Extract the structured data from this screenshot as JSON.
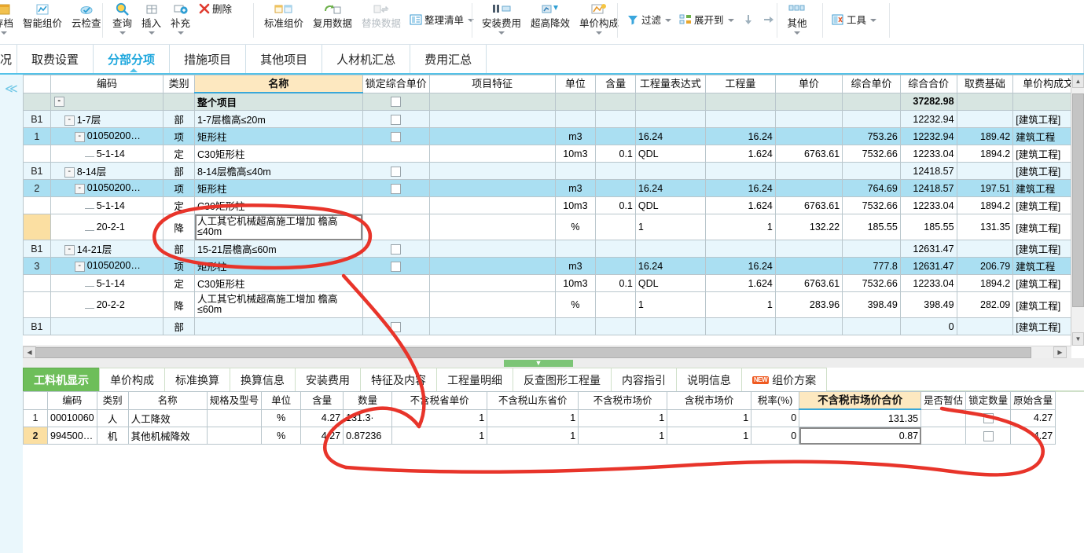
{
  "ribbon": {
    "groups": [
      {
        "items": [
          {
            "label": "存档",
            "icon": "archive-icon",
            "caret": true
          },
          {
            "label": "智能组价",
            "icon": "smart-price-icon",
            "caret": false
          },
          {
            "label": "云检查",
            "icon": "cloud-check-icon",
            "caret": false
          }
        ]
      },
      {
        "items": [
          {
            "label": "查询",
            "icon": "search-icon",
            "caret": true
          },
          {
            "label": "插入",
            "icon": "insert-row-icon",
            "caret": true
          },
          {
            "label": "补充",
            "icon": "supplement-icon",
            "caret": true
          },
          {
            "label": "删除",
            "icon": "delete-icon",
            "caret": false,
            "inline": true
          }
        ]
      },
      {
        "items": [
          {
            "label": "标准组价",
            "icon": "standard-price-icon",
            "caret": false
          },
          {
            "label": "复用数据",
            "icon": "reuse-data-icon",
            "caret": false
          },
          {
            "label": "替换数据",
            "icon": "replace-data-icon",
            "caret": false,
            "disabled": true
          },
          {
            "label": "整理清单",
            "icon": "organize-list-icon",
            "caret": true,
            "inline": true
          }
        ]
      },
      {
        "items": [
          {
            "label": "安装费用",
            "icon": "install-fee-icon",
            "caret": true
          },
          {
            "label": "超高降效",
            "icon": "height-efficiency-icon",
            "caret": false
          },
          {
            "label": "单价构成",
            "icon": "unit-price-composition-icon",
            "caret": true
          }
        ]
      },
      {
        "items": [
          {
            "label": "过滤",
            "icon": "filter-icon",
            "caret": true,
            "inline": true
          },
          {
            "label": "展开到",
            "icon": "expand-to-icon",
            "caret": true,
            "inline": true
          },
          {
            "label": "",
            "icon": "arrow-down-icon",
            "caret": false,
            "inline": true
          },
          {
            "label": "",
            "icon": "arrow-right-icon",
            "caret": false,
            "inline": true
          }
        ]
      },
      {
        "items": [
          {
            "label": "其他",
            "icon": "other-icon",
            "caret": true
          }
        ]
      },
      {
        "items": [
          {
            "label": "工具",
            "icon": "tools-icon",
            "caret": true,
            "inline": true
          }
        ]
      }
    ]
  },
  "main_tabs": {
    "leading_partial": "况",
    "items": [
      {
        "label": "取费设置",
        "active": false
      },
      {
        "label": "分部分项",
        "active": true
      },
      {
        "label": "措施项目",
        "active": false
      },
      {
        "label": "其他项目",
        "active": false
      },
      {
        "label": "人材机汇总",
        "active": false
      },
      {
        "label": "费用汇总",
        "active": false
      }
    ]
  },
  "top_grid": {
    "columns": [
      "编码",
      "类别",
      "名称",
      "锁定综合单价",
      "项目特征",
      "单位",
      "含量",
      "工程量表达式",
      "工程量",
      "单价",
      "综合单价",
      "综合合价",
      "取费基础",
      "单价构成文"
    ],
    "selected_column": "名称",
    "rows": [
      {
        "rowhd": "",
        "type": "proj",
        "code": "",
        "cat": "",
        "name": "整个项目",
        "lock": true,
        "feature": "",
        "unit": "",
        "content": "",
        "expr": "",
        "qty": "",
        "price": "",
        "uprice": "",
        "total": "37282.98",
        "base": "",
        "compose": "",
        "indent": 0,
        "expander": "-"
      },
      {
        "rowhd": "B1",
        "type": "bu",
        "code": "1-7层",
        "cat": "部",
        "name": "1-7层檐高≤20m",
        "lock": true,
        "feature": "",
        "unit": "",
        "content": "",
        "expr": "",
        "qty": "",
        "price": "",
        "uprice": "",
        "total": "12232.94",
        "base": "",
        "compose": "[建筑工程]",
        "indent": 1,
        "expander": "-"
      },
      {
        "rowhd": "1",
        "type": "item",
        "code": "01050200…",
        "cat": "项",
        "name": "矩形柱",
        "lock": true,
        "feature": "",
        "unit": "m3",
        "content": "",
        "expr": "16.24",
        "qty": "16.24",
        "price": "",
        "uprice": "753.26",
        "total": "12232.94",
        "base": "189.42",
        "compose": "建筑工程",
        "indent": 2,
        "expander": "-"
      },
      {
        "rowhd": "",
        "type": "det",
        "code": "5-1-14",
        "cat": "定",
        "name": "C30矩形柱",
        "lock": false,
        "feature": "",
        "unit": "10m3",
        "content": "0.1",
        "expr": "QDL",
        "qty": "1.624",
        "price": "6763.61",
        "uprice": "7532.66",
        "total": "12233.04",
        "base": "1894.2",
        "compose": "[建筑工程]",
        "indent": 3,
        "expander": ""
      },
      {
        "rowhd": "B1",
        "type": "bu",
        "code": "8-14层",
        "cat": "部",
        "name": "8-14层檐高≤40m",
        "lock": true,
        "feature": "",
        "unit": "",
        "content": "",
        "expr": "",
        "qty": "",
        "price": "",
        "uprice": "",
        "total": "12418.57",
        "base": "",
        "compose": "[建筑工程]",
        "indent": 1,
        "expander": "-"
      },
      {
        "rowhd": "2",
        "type": "item",
        "code": "01050200…",
        "cat": "项",
        "name": "矩形柱",
        "lock": true,
        "feature": "",
        "unit": "m3",
        "content": "",
        "expr": "16.24",
        "qty": "16.24",
        "price": "",
        "uprice": "764.69",
        "total": "12418.57",
        "base": "197.51",
        "compose": "建筑工程",
        "indent": 2,
        "expander": "-"
      },
      {
        "rowhd": "",
        "type": "det",
        "code": "5-1-14",
        "cat": "定",
        "name": "C30矩形柱",
        "lock": false,
        "feature": "",
        "unit": "10m3",
        "content": "0.1",
        "expr": "QDL",
        "qty": "1.624",
        "price": "6763.61",
        "uprice": "7532.66",
        "total": "12233.04",
        "base": "1894.2",
        "compose": "[建筑工程]",
        "indent": 3,
        "expander": ""
      },
      {
        "rowhd": "",
        "type": "cur",
        "code": "20-2-1",
        "cat": "降",
        "name": "人工其它机械超高施工增加  檐高≤40m",
        "lock": false,
        "feature": "",
        "unit": "%",
        "content": "",
        "expr": "1",
        "qty": "1",
        "price": "132.22",
        "uprice": "185.55",
        "total": "185.55",
        "base": "131.35",
        "compose": "[建筑工程]",
        "indent": 3,
        "expander": "",
        "selected_name": true,
        "tall": true
      },
      {
        "rowhd": "B1",
        "type": "bu",
        "code": "14-21层",
        "cat": "部",
        "name": "15-21层檐高≤60m",
        "lock": true,
        "feature": "",
        "unit": "",
        "content": "",
        "expr": "",
        "qty": "",
        "price": "",
        "uprice": "",
        "total": "12631.47",
        "base": "",
        "compose": "[建筑工程]",
        "indent": 1,
        "expander": "-"
      },
      {
        "rowhd": "3",
        "type": "item",
        "code": "01050200…",
        "cat": "项",
        "name": "矩形柱",
        "lock": true,
        "feature": "",
        "unit": "m3",
        "content": "",
        "expr": "16.24",
        "qty": "16.24",
        "price": "",
        "uprice": "777.8",
        "total": "12631.47",
        "base": "206.79",
        "compose": "建筑工程",
        "indent": 2,
        "expander": "-"
      },
      {
        "rowhd": "",
        "type": "det",
        "code": "5-1-14",
        "cat": "定",
        "name": "C30矩形柱",
        "lock": false,
        "feature": "",
        "unit": "10m3",
        "content": "0.1",
        "expr": "QDL",
        "qty": "1.624",
        "price": "6763.61",
        "uprice": "7532.66",
        "total": "12233.04",
        "base": "1894.2",
        "compose": "[建筑工程]",
        "indent": 3,
        "expander": ""
      },
      {
        "rowhd": "",
        "type": "det",
        "code": "20-2-2",
        "cat": "降",
        "name": "人工其它机械超高施工增加  檐高≤60m",
        "lock": false,
        "feature": "",
        "unit": "%",
        "content": "",
        "expr": "1",
        "qty": "1",
        "price": "283.96",
        "uprice": "398.49",
        "total": "398.49",
        "base": "282.09",
        "compose": "[建筑工程]",
        "indent": 3,
        "expander": "",
        "tall": true
      },
      {
        "rowhd": "B1",
        "type": "bu",
        "code": "",
        "cat": "部",
        "name": "",
        "lock": true,
        "feature": "",
        "unit": "",
        "content": "",
        "expr": "",
        "qty": "",
        "price": "",
        "uprice": "",
        "total": "0",
        "base": "",
        "compose": "[建筑工程]",
        "indent": 1,
        "expander": ""
      }
    ]
  },
  "bottom_tabs": {
    "items": [
      {
        "label": "工料机显示",
        "active": true,
        "badge": ""
      },
      {
        "label": "单价构成",
        "active": false,
        "badge": ""
      },
      {
        "label": "标准换算",
        "active": false,
        "badge": ""
      },
      {
        "label": "换算信息",
        "active": false,
        "badge": ""
      },
      {
        "label": "安装费用",
        "active": false,
        "badge": ""
      },
      {
        "label": "特征及内容",
        "active": false,
        "badge": ""
      },
      {
        "label": "工程量明细",
        "active": false,
        "badge": ""
      },
      {
        "label": "反查图形工程量",
        "active": false,
        "badge": ""
      },
      {
        "label": "内容指引",
        "active": false,
        "badge": ""
      },
      {
        "label": "说明信息",
        "active": false,
        "badge": ""
      },
      {
        "label": "组价方案",
        "active": false,
        "badge": "NEW"
      }
    ]
  },
  "bottom_grid": {
    "columns": [
      "编码",
      "类别",
      "名称",
      "规格及型号",
      "单位",
      "含量",
      "数量",
      "不含税省单价",
      "不含税山东省价",
      "不含税市场价",
      "含税市场价",
      "税率(%)",
      "不含税市场价合价",
      "是否暂估",
      "锁定数量",
      "原始含量"
    ],
    "selected_column": "不含税市场价合价",
    "rows": [
      {
        "no": "1",
        "code": "00010060",
        "cat": "人",
        "name": "人工降效",
        "spec": "",
        "unit": "%",
        "content": "4.27",
        "qty": "131.3·",
        "p1": "1",
        "p2": "1",
        "p3": "1",
        "p4": "1",
        "tax": "0",
        "total": "131.35",
        "estimate": "",
        "locked": false,
        "orig": "4.27",
        "current": false
      },
      {
        "no": "2",
        "code": "994500…",
        "cat": "机",
        "name": "其他机械降效",
        "spec": "",
        "unit": "%",
        "content": "4.27",
        "qty": "0.87236",
        "p1": "1",
        "p2": "1",
        "p3": "1",
        "p4": "1",
        "tax": "0",
        "total": "0.87",
        "estimate": "",
        "locked": false,
        "orig": "4.27",
        "current": true
      }
    ]
  },
  "annotation": {
    "color": "#e8342a",
    "shapes": [
      "ellipse-around-name-cell",
      "line-down-to-bottom-grid",
      "ellipse-around-quantity-column",
      "long-sweep-underline"
    ]
  }
}
